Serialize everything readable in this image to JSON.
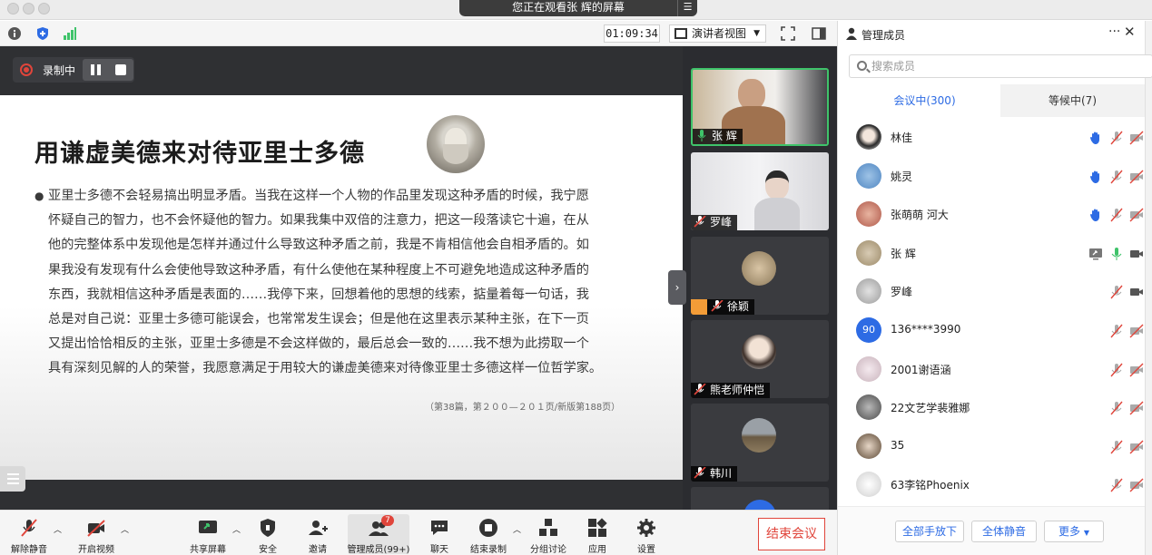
{
  "window": {
    "share_banner": "您正在观看张 辉的屏幕",
    "share_menu_icon": "menu-icon"
  },
  "meeting_toolbar": {
    "timer": "01:09:34",
    "view_mode": "演讲者视图",
    "icons": [
      "info-icon",
      "shield-icon",
      "signal-icon",
      "fullscreen-icon",
      "layout-icon"
    ]
  },
  "recording": {
    "label": "录制中"
  },
  "slide": {
    "title": "用谦虚美德来对待亚里士多德",
    "body_lines": [
      "亚里士多德不会轻易搞出明显矛盾。当我在这样一个人物的作品里发现这种矛盾的时候，我宁愿",
      "怀疑自己的智力，也不会怀疑他的智力。如果我集中双倍的注意力，把这一段落读它十遍，在从",
      "他的完整体系中发现他是怎样并通过什么导致这种矛盾之前，我是不肯相信他会自相矛盾的。如",
      "果我没有发现有什么会使他导致这种矛盾，有什么使他在某种程度上不可避免地造成这种矛盾的",
      "东西，我就相信这种矛盾是表面的……我停下来，回想着他的思想的线索，掂量着每一句话，我",
      "总是对自己说：亚里士多德可能误会，也常常发生误会；但是他在这里表示某种主张，在下一页",
      "又提出恰恰相反的主张，亚里士多德是不会这样做的，最后总会一致的……我不想为此捞取一个",
      "具有深刻见解的人的荣誉，我愿意满足于用较大的谦虚美德来对待像亚里士多德这样一位哲学家。"
    ],
    "citation": "（第38篇，第２００—２０１页/新版第188页）"
  },
  "video_tiles": [
    {
      "name": "张 辉",
      "mic": "mic-on-icon",
      "active": true
    },
    {
      "name": "罗峰",
      "mic": "mic-muted-icon",
      "active": false
    },
    {
      "name": "徐颖",
      "mic": "mic-muted-icon",
      "active": false
    },
    {
      "name": "熊老师仲恺",
      "mic": "mic-muted-icon",
      "active": false
    },
    {
      "name": "韩川",
      "mic": "mic-muted-icon",
      "active": false
    }
  ],
  "bottom_toolbar": {
    "unmute": "解除静音",
    "start_video": "开启视频",
    "share_screen": "共享屏幕",
    "security": "安全",
    "invite": "邀请",
    "manage_participants": "管理成员(99+)",
    "participants_badge": "7",
    "chat": "聊天",
    "end_recording": "结束录制",
    "breakout": "分组讨论",
    "apps": "应用",
    "settings": "设置",
    "end_meeting": "结束会议"
  },
  "panel": {
    "title": "管理成员",
    "search_placeholder": "搜索成员",
    "tabs": [
      {
        "label": "会议中(300)",
        "active": true
      },
      {
        "label": "等候中(7)",
        "active": false
      }
    ],
    "participants": [
      {
        "name": "林佳",
        "hand_raised": true,
        "sharing": false,
        "mic": "muted",
        "video": "off"
      },
      {
        "name": "姚灵",
        "hand_raised": true,
        "sharing": false,
        "mic": "muted",
        "video": "off"
      },
      {
        "name": "张萌萌 河大",
        "hand_raised": true,
        "sharing": false,
        "mic": "muted",
        "video": "off"
      },
      {
        "name": "张 辉",
        "hand_raised": false,
        "sharing": true,
        "mic": "on",
        "video": "on"
      },
      {
        "name": "罗峰",
        "hand_raised": false,
        "sharing": false,
        "mic": "muted",
        "video": "on"
      },
      {
        "name": "136****3990",
        "avatar_text": "90",
        "hand_raised": false,
        "sharing": false,
        "mic": "muted",
        "video": "off"
      },
      {
        "name": "2001谢语涵",
        "hand_raised": false,
        "sharing": false,
        "mic": "muted",
        "video": "off"
      },
      {
        "name": "22文艺学裴雅娜",
        "hand_raised": false,
        "sharing": false,
        "mic": "muted",
        "video": "off"
      },
      {
        "name": "35",
        "hand_raised": false,
        "sharing": false,
        "mic": "muted",
        "video": "off"
      },
      {
        "name": "63李铭Phoenix",
        "hand_raised": false,
        "sharing": false,
        "mic": "muted",
        "video": "off"
      }
    ],
    "footer": {
      "lower_all_hands": "全部手放下",
      "mute_all": "全体静音",
      "more": "更多"
    }
  },
  "colors": {
    "accent": "#2d6be4",
    "danger": "#e0453b",
    "active_speaker": "#3fc36a",
    "stage_bg": "#2f3033"
  }
}
